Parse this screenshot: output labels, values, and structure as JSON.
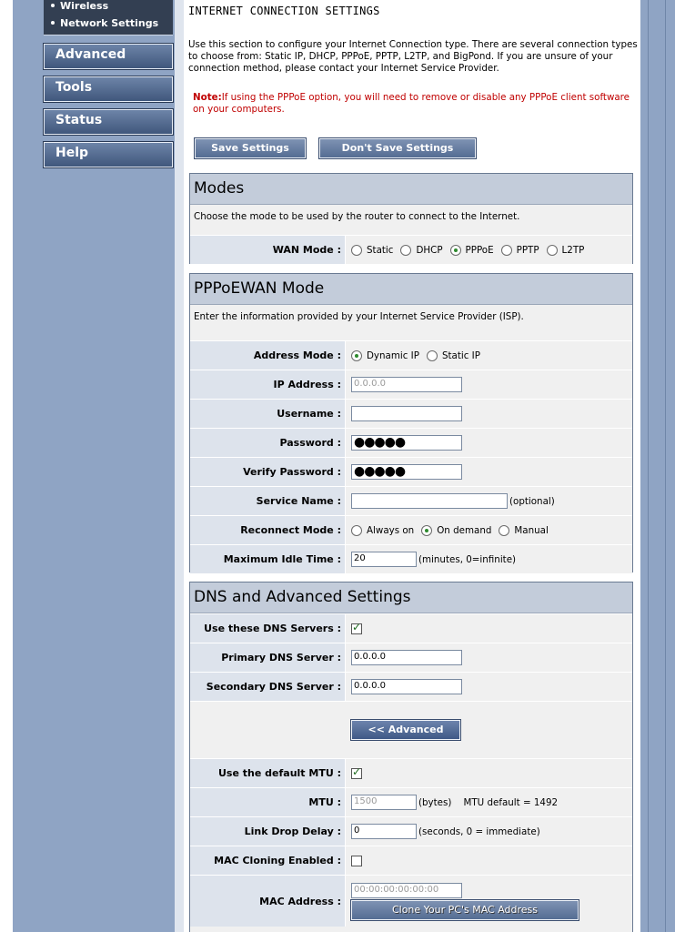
{
  "sidebar": {
    "subitems": [
      "Wireless",
      "Network Settings"
    ],
    "buttons": [
      "Advanced",
      "Tools",
      "Status",
      "Help"
    ]
  },
  "page": {
    "title": "INTERNET CONNECTION SETTINGS",
    "intro": "Use this section to configure your Internet Connection type. There are several connection types to choose from: Static IP, DHCP, PPPoE, PPTP, L2TP, and BigPond. If you are unsure of your connection method, please contact your Internet Service Provider.",
    "note_label": "Note:",
    "note_text": "If using the PPPoE option, you will need to remove or disable any PPPoE client software on your computers.",
    "save_label": "Save Settings",
    "dont_save_label": "Don't Save Settings"
  },
  "modes": {
    "title": "Modes",
    "desc": "Choose the mode to be used by the router to connect to the Internet.",
    "wan_label": "WAN Mode :",
    "options": [
      "Static",
      "DHCP",
      "PPPoE",
      "PPTP",
      "L2TP"
    ],
    "selected": "PPPoE"
  },
  "pppoe": {
    "title": "PPPoEWAN Mode",
    "desc": "Enter the information provided by your Internet Service Provider (ISP).",
    "address_mode_label": "Address Mode :",
    "address_options": [
      "Dynamic IP",
      "Static IP"
    ],
    "ip_label": "IP Address :",
    "ip_value": "0.0.0.0",
    "username_label": "Username :",
    "username_value": "",
    "password_label": "Password :",
    "password_value": "●●●●●",
    "verify_label": "Verify Password :",
    "verify_value": "●●●●●",
    "service_label": "Service Name :",
    "service_value": "",
    "service_note": "(optional)",
    "reconnect_label": "Reconnect Mode :",
    "reconnect_options": [
      "Always on",
      "On demand",
      "Manual"
    ],
    "idle_label": "Maximum Idle Time :",
    "idle_value": "20",
    "idle_note": "(minutes, 0=infinite)"
  },
  "dns": {
    "title": "DNS and Advanced Settings",
    "use_dns_label": "Use these DNS Servers :",
    "primary_label": "Primary DNS Server :",
    "primary_value": "0.0.0.0",
    "secondary_label": "Secondary DNS Server :",
    "secondary_value": "0.0.0.0",
    "advanced_button": "<< Advanced",
    "default_mtu_label": "Use the default MTU :",
    "mtu_label": "MTU :",
    "mtu_value": "1500",
    "mtu_note": "(bytes)    MTU default = 1492",
    "link_drop_label": "Link Drop Delay :",
    "link_drop_value": "0",
    "link_drop_note": "(seconds, 0 = immediate)",
    "mac_cloning_label": "MAC Cloning Enabled :",
    "mac_label": "MAC Address :",
    "mac_value": "00:00:00:00:00:00",
    "clone_button": "Clone Your PC's MAC Address"
  }
}
